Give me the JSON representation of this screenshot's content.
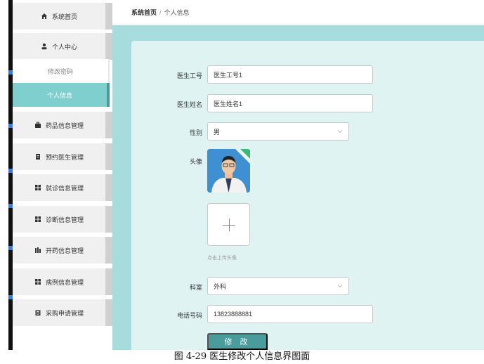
{
  "sidebar": {
    "items": [
      {
        "label": "系统首页",
        "icon": "home-icon"
      },
      {
        "label": "个人中心",
        "icon": "user-icon"
      },
      {
        "label": "药品信息管理",
        "icon": "briefcase-icon"
      },
      {
        "label": "预约医生管理",
        "icon": "document-icon"
      },
      {
        "label": "就诊信息管理",
        "icon": "grid-icon"
      },
      {
        "label": "诊断信息管理",
        "icon": "grid-icon"
      },
      {
        "label": "开药信息管理",
        "icon": "bars-icon"
      },
      {
        "label": "病例信息管理",
        "icon": "grid-icon"
      },
      {
        "label": "采购申请管理",
        "icon": "clipboard-icon"
      }
    ],
    "submenu": [
      {
        "label": "修改密码"
      },
      {
        "label": "个人信息",
        "active": true
      }
    ]
  },
  "breadcrumb": {
    "home": "系统首页",
    "separator": "/",
    "current": "个人信息"
  },
  "form": {
    "doctor_id": {
      "label": "医生工号",
      "value": "医生工号1"
    },
    "doctor_name": {
      "label": "医生姓名",
      "value": "医生姓名1"
    },
    "gender": {
      "label": "性别",
      "value": "男"
    },
    "avatar": {
      "label": "头像",
      "upload_hint": "点击上传头像"
    },
    "department": {
      "label": "科室",
      "value": "外科"
    },
    "phone": {
      "label": "电话号码",
      "value": "13823888881"
    },
    "submit_label": "修 改"
  },
  "caption": "图 4-29 医生修改个人信息界图面",
  "colors": {
    "accent": "#4a9b9b",
    "active_menu": "#7fcfcf",
    "content_bg": "#a6dcdc",
    "panel_bg": "#dff3f3"
  }
}
